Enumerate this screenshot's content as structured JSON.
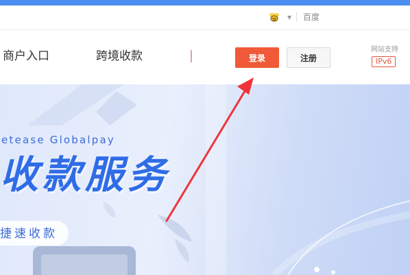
{
  "utility_bar": {
    "bee_icon": "bee-icon",
    "dropdown_icon": "caret-down-icon",
    "baidu_label": "百度"
  },
  "nav": {
    "merchant_entry": "商户入口",
    "cross_border": "跨境收款",
    "login_label": "登录",
    "register_label": "注册",
    "ipv6_support_label": "网站支持",
    "ipv6_badge": "IPv6"
  },
  "hero": {
    "subtitle": "etease Globalpay",
    "title": "收款服务",
    "pill_text": "捷速收款"
  },
  "colors": {
    "accent_blue": "#4a8ef0",
    "login_red": "#f05a38",
    "annotation_arrow": "#f0333a"
  }
}
